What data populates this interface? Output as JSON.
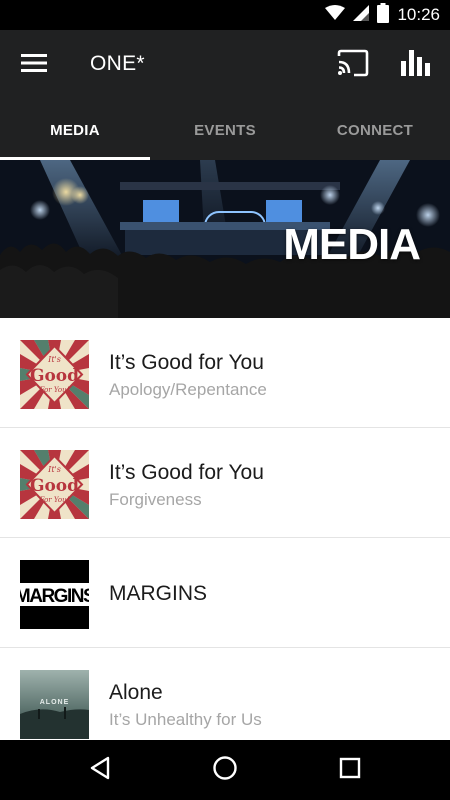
{
  "status_bar": {
    "time": "10:26",
    "icons": [
      "wifi-icon",
      "cell-signal-icon",
      "battery-icon"
    ]
  },
  "app_bar": {
    "title": "ONE*",
    "icons": [
      "menu-icon",
      "cast-icon",
      "bar-chart-icon"
    ]
  },
  "tabs": [
    {
      "label": "MEDIA",
      "active": true
    },
    {
      "label": "EVENTS",
      "active": false
    },
    {
      "label": "CONNECT",
      "active": false
    }
  ],
  "hero": {
    "title": "MEDIA"
  },
  "media_items": [
    {
      "title": "It’s Good for You",
      "subtitle": "Apology/Repentance",
      "thumb_icon": "its-good-for-you-artwork-icon"
    },
    {
      "title": "It’s Good for You",
      "subtitle": "Forgiveness",
      "thumb_icon": "its-good-for-you-artwork-icon"
    },
    {
      "title": "MARGINS",
      "subtitle": "",
      "thumb_icon": "margins-artwork-icon"
    },
    {
      "title": "Alone",
      "subtitle": "It’s Unhealthy for Us",
      "thumb_icon": "alone-artwork-icon"
    }
  ],
  "artwork_text": {
    "good_top": "It's",
    "good_main": "Good",
    "good_bottom": "For You!",
    "margins": "MARGINS",
    "alone": "ALONE"
  },
  "nav_bar": {
    "icons": [
      "back-icon",
      "home-icon",
      "recents-icon"
    ]
  },
  "colors": {
    "bar_background": "#202122",
    "status_background": "#000000",
    "tab_active": "#ffffff",
    "tab_inactive": "#9a9a9a",
    "subtitle": "#a6a6a6"
  }
}
